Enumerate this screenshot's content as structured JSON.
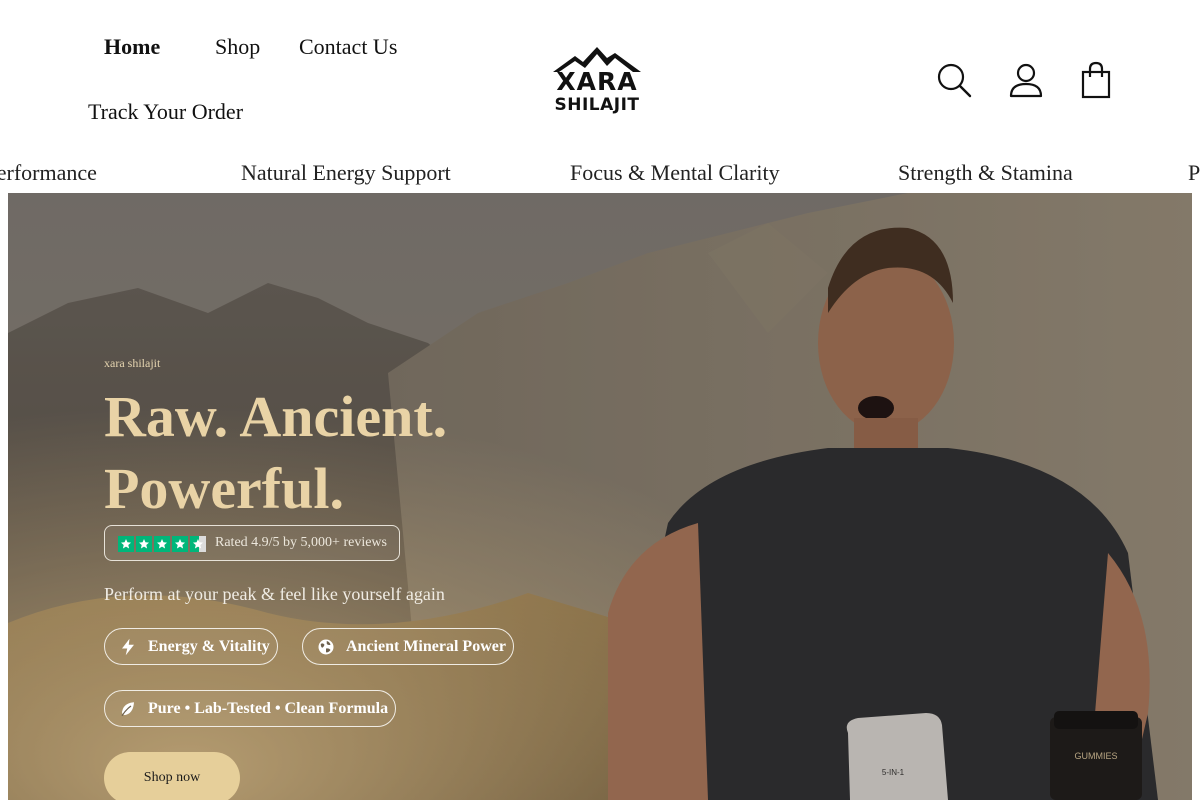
{
  "header": {
    "nav": {
      "home": "Home",
      "shop": "Shop",
      "contact": "Contact Us",
      "track_order": "Track Your Order"
    },
    "logo": {
      "line1": "XARA",
      "line2": "SHILAJIT"
    },
    "icons": {
      "search": "search-icon",
      "account": "user-icon",
      "cart": "shopping-bag-icon"
    }
  },
  "marquee": {
    "items": [
      "k Performance",
      "Natural Energy Support",
      "Focus & Mental Clarity",
      "Strength & Stamina",
      "P"
    ]
  },
  "hero": {
    "eyebrow": "xara shilajit",
    "headline_line1": "Raw. Ancient.",
    "headline_line2": "Powerful.",
    "rating": {
      "stars": 4.5,
      "text": "Rated 4.9/5 by 5,000+ reviews"
    },
    "tagline": "Perform at your peak & feel like yourself again",
    "features": [
      {
        "label": "Energy & Vitality",
        "icon": "lightning-icon"
      },
      {
        "label": "Ancient Mineral Power",
        "icon": "globe-icon"
      },
      {
        "label": "Pure • Lab-Tested • Clean Formula",
        "icon": "leaf-icon"
      }
    ],
    "cta": "Shop now"
  },
  "colors": {
    "headline": "#e9d3a6",
    "cta_bg": "#e6cf9a",
    "star_green": "#00b67a"
  }
}
